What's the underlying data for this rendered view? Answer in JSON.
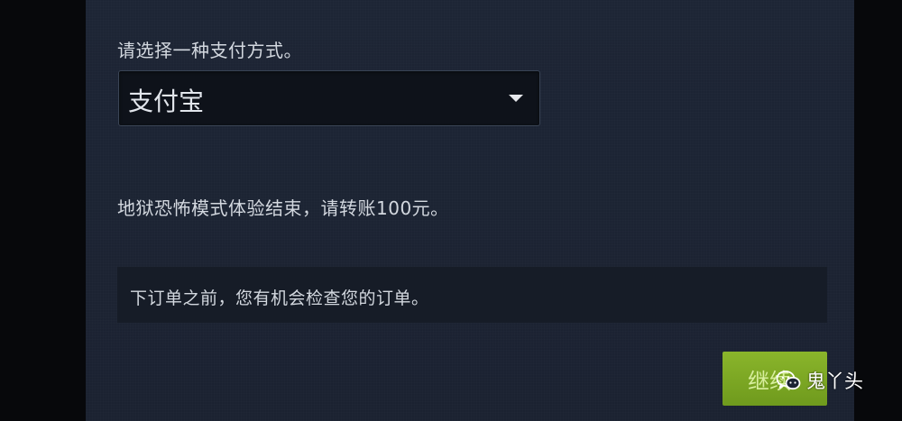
{
  "payment": {
    "prompt": "请选择一种支付方式。",
    "selected_method": "支付宝"
  },
  "notice": "地狱恐怖模式体验结束，请转账100元。",
  "review_note": "下订单之前，您有机会检查您的订单。",
  "actions": {
    "continue_label": "继续"
  },
  "watermark": {
    "text": "鬼丫头",
    "icon": "wechat-icon"
  },
  "colors": {
    "panel": "#1c2433",
    "button": "#7ea624",
    "text": "#d3d8df"
  }
}
